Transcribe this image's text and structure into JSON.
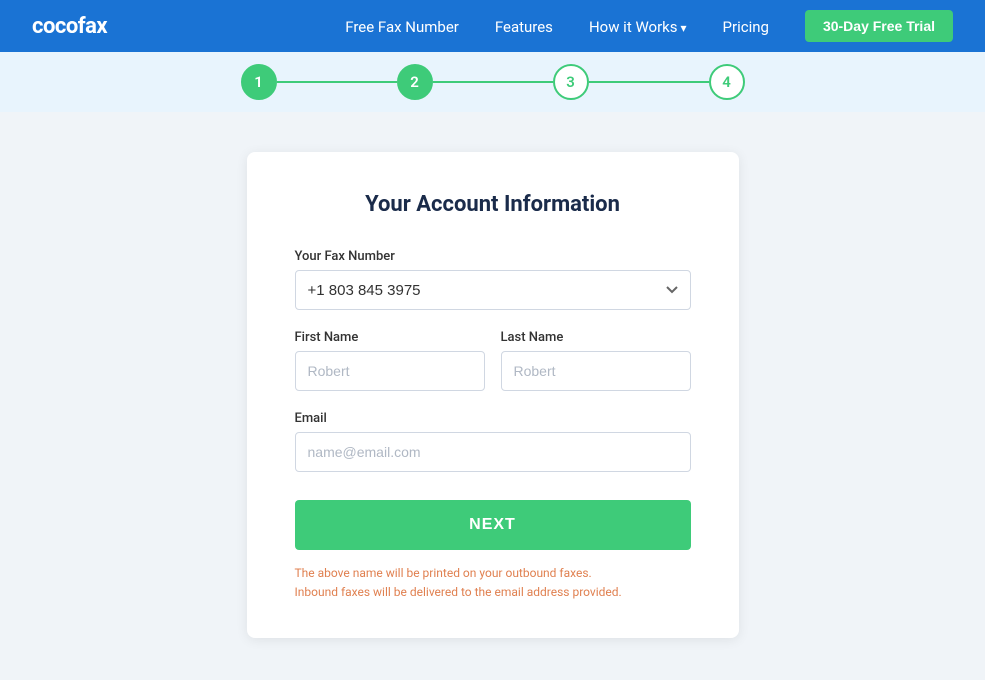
{
  "navbar": {
    "logo": "cocofax",
    "links": [
      {
        "label": "Free Fax Number",
        "hasArrow": false
      },
      {
        "label": "Features",
        "hasArrow": false
      },
      {
        "label": "How it Works",
        "hasArrow": true
      },
      {
        "label": "Pricing",
        "hasArrow": false
      }
    ],
    "cta_label": "30-Day Free Trial"
  },
  "steps": [
    {
      "number": "1",
      "type": "filled"
    },
    {
      "number": "2",
      "type": "filled"
    },
    {
      "number": "3",
      "type": "outline"
    },
    {
      "number": "4",
      "type": "outline"
    }
  ],
  "form": {
    "title": "Your Account Information",
    "fax_number_label": "Your Fax Number",
    "fax_number_value": "+1 803 845 3975",
    "first_name_label": "First Name",
    "first_name_placeholder": "Robert",
    "last_name_label": "Last Name",
    "last_name_placeholder": "Robert",
    "email_label": "Email",
    "email_placeholder": "name@email.com",
    "next_button": "NEXT",
    "note_line1": "The above name will be printed on your outbound faxes.",
    "note_line2": "Inbound faxes will be delivered to the email address provided."
  }
}
